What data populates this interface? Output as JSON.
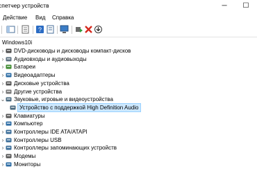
{
  "window": {
    "title": "спетчер устройств",
    "minimize_glyph": "─",
    "maximize_glyph": "☐"
  },
  "menu": {
    "items": [
      {
        "label": "Действие"
      },
      {
        "label": "Вид"
      },
      {
        "label": "Справка"
      }
    ]
  },
  "toolbar": {
    "icons": [
      "console-tree-icon",
      "properties-icon",
      "help-icon",
      "computer-scan-icon",
      "enable-device-icon",
      "uninstall-icon",
      "download-driver-icon"
    ]
  },
  "tree": {
    "root": "Windows10i",
    "items": [
      {
        "label": "DVD-дисководы и дисководы компакт-дисков",
        "icon": "dvd-icon",
        "color": "#4a4a4a"
      },
      {
        "label": "Аудиовходы и аудиовыходы",
        "icon": "speaker-icon",
        "color": "#5a6e7e"
      },
      {
        "label": "Батареи",
        "icon": "battery-icon",
        "color": "#3c8a2e"
      },
      {
        "label": "Видеоадаптеры",
        "icon": "display-adapter-icon",
        "color": "#2f6ea5"
      },
      {
        "label": "Дисковые устройства",
        "icon": "disk-icon",
        "color": "#555555"
      },
      {
        "label": "Другие устройства",
        "icon": "unknown-device-icon",
        "color": "#777777"
      },
      {
        "label": "Звуковые, игровые и видеоустройства",
        "icon": "sound-icon",
        "color": "#4a6a80",
        "expanded": true
      },
      {
        "label": "Устройство с поддержкой High Definition Audio",
        "icon": "audio-device-icon",
        "color": "#4a6a80",
        "child": true,
        "selected": true
      },
      {
        "label": "Клавиатуры",
        "icon": "keyboard-icon",
        "color": "#555555"
      },
      {
        "label": "Компьютер",
        "icon": "computer-icon",
        "color": "#2f6ea5"
      },
      {
        "label": "Контроллеры IDE ATA/ATAPI",
        "icon": "ide-controller-icon",
        "color": "#3a6d99"
      },
      {
        "label": "Контроллеры USB",
        "icon": "usb-icon",
        "color": "#3a6d99"
      },
      {
        "label": "Контроллеры запоминающих устройств",
        "icon": "storage-controller-icon",
        "color": "#3a6d99"
      },
      {
        "label": "Модемы",
        "icon": "modem-icon",
        "color": "#555555"
      },
      {
        "label": "Мониторы",
        "icon": "monitor-icon",
        "color": "#2f6ea5"
      }
    ]
  }
}
